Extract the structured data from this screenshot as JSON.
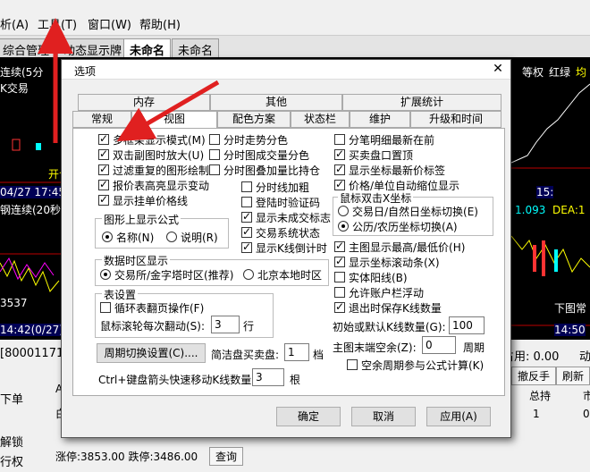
{
  "menu": [
    "析(A)",
    "工具(T)",
    "窗口(W)",
    "帮助(H)"
  ],
  "tabs_bg": [
    "综合管理",
    "动态显示牌",
    "未命名",
    "未命名"
  ],
  "bg_text": {
    "l1": "连续(5分",
    "l2": "K交易",
    "l3": "开仑",
    "l4": "04/27 17:45",
    "l5": "钢连续(20秒",
    "l6": "3537",
    "l7": "14:42(0/27)",
    "r1": "等权",
    "r2": "红绿",
    "r3": "均",
    "r4": "15:",
    "r5": "DEA:1",
    "r6": "1.093",
    "r7": "下图常",
    "r8": "14:50",
    "b1": "[80001171]",
    "b2": "下单",
    "b3": "解锁",
    "b4": "行权",
    "b5": "涨停:3853.00 跌停:3486.00",
    "b6": "查询",
    "b7": "占用: 0.00",
    "b8": "动",
    "b9": "撤反手",
    "b10": "刷新",
    "b11": "总持",
    "b12": "1",
    "b13": "0",
    "b14": "市",
    "b15": "AG",
    "b16": "白"
  },
  "dialog": {
    "title": "选项",
    "tabs_row1": [
      "内存",
      "其他",
      "扩展统计"
    ],
    "tabs_row2": [
      "常规",
      "视图",
      "配色方案",
      "状态栏",
      "维护",
      "升级和时间"
    ],
    "col1": [
      {
        "label": "多框架显示模式(M)",
        "checked": true
      },
      {
        "label": "双击副图时放大(U)",
        "checked": true
      },
      {
        "label": "过滤重复的图形绘制",
        "checked": true
      },
      {
        "label": "报价表高亮显示变动",
        "checked": true
      },
      {
        "label": "显示挂单价格线",
        "checked": true
      }
    ],
    "col2": [
      {
        "label": "分时走势分色",
        "checked": false
      },
      {
        "label": "分时图成交量分色",
        "checked": false
      },
      {
        "label": "分时图叠加量比持仓",
        "checked": false
      },
      {
        "label": "分时线加粗",
        "checked": false
      },
      {
        "label": "登陆时验证码",
        "checked": false
      },
      {
        "label": "显示未成交标志",
        "checked": true
      },
      {
        "label": "交易系统状态",
        "checked": true
      },
      {
        "label": "显示K线倒计时",
        "checked": true
      }
    ],
    "col3": [
      {
        "label": "分笔明细最新在前",
        "checked": false
      },
      {
        "label": "买卖盘口置顶",
        "checked": true
      },
      {
        "label": "显示坐标最新价标签",
        "checked": true
      },
      {
        "label": "价格/单位自动缩位显示",
        "checked": true
      }
    ],
    "formula_group": "图形上显示公式",
    "formula_opts": [
      {
        "label": "名称(N)",
        "on": true
      },
      {
        "label": "说明(R)",
        "on": false
      }
    ],
    "xaxis_group": "鼠标双击X坐标",
    "xaxis_opts": [
      {
        "label": "交易日/自然日坐标切换(E)",
        "on": false
      },
      {
        "label": "公历/农历坐标切换(A)",
        "on": true
      }
    ],
    "col3b": [
      {
        "label": "主图显示最高/最低价(H)",
        "checked": true
      },
      {
        "label": "显示坐标滚动条(X)",
        "checked": true
      },
      {
        "label": "实体阳线(B)",
        "checked": false
      },
      {
        "label": "允许账户栏浮动",
        "checked": false
      },
      {
        "label": "退出时保存K线数量",
        "checked": true
      }
    ],
    "tz_group": "数据时区显示",
    "tz_opts": [
      {
        "label": "交易所/金字塔时区(推荐)",
        "on": true
      },
      {
        "label": "北京本地时区",
        "on": false
      }
    ],
    "page_group": "表设置",
    "page_cb": {
      "label": "循环表翻页操作(F)",
      "checked": false
    },
    "wheel_label": "鼠标滚轮每次翻动(S):",
    "wheel_value": "3",
    "wheel_unit": "行",
    "init_k_label": "初始或默认K线数量(G):",
    "init_k_value": "100",
    "period_btn": "周期切换设置(C)....",
    "simple_label": "简洁盘买卖盘:",
    "simple_value": "1",
    "simple_unit": "档",
    "blank_label": "主图末端空余(Z):",
    "blank_value": "0",
    "blank_unit": "周期",
    "blank_cb": {
      "label": "空余周期参与公式计算(K)",
      "checked": false
    },
    "ctrl_label": "Ctrl+键盘箭头快速移动K线数量",
    "ctrl_value": "3",
    "ctrl_unit": "根",
    "ok": "确定",
    "cancel": "取消",
    "apply": "应用(A)"
  }
}
